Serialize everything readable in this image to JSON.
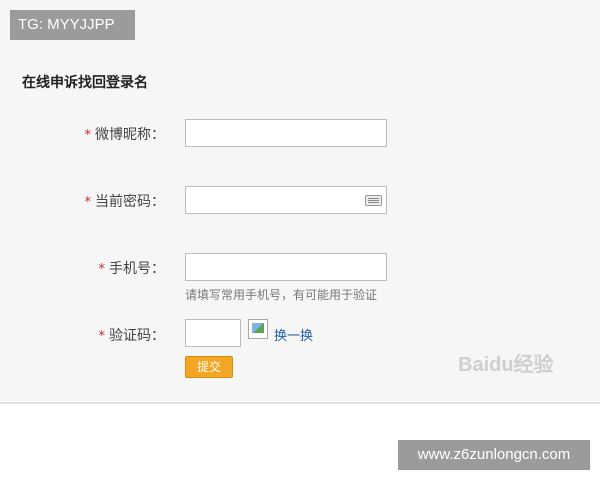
{
  "overlay": {
    "tg_badge": "TG: MYYJJPP",
    "footer_url": "www.z6zunlongcn.com",
    "watermark": "Baidu经验"
  },
  "form": {
    "title": "在线申诉找回登录名",
    "required_mark": "*",
    "fields": {
      "nickname_label": "微博昵称：",
      "password_label": "当前密码：",
      "phone_label": "手机号：",
      "phone_hint": "请填写常用手机号，有可能用于验证",
      "captcha_label": "验证码："
    },
    "captcha_refresh": "换一换",
    "submit_label": "提交"
  }
}
